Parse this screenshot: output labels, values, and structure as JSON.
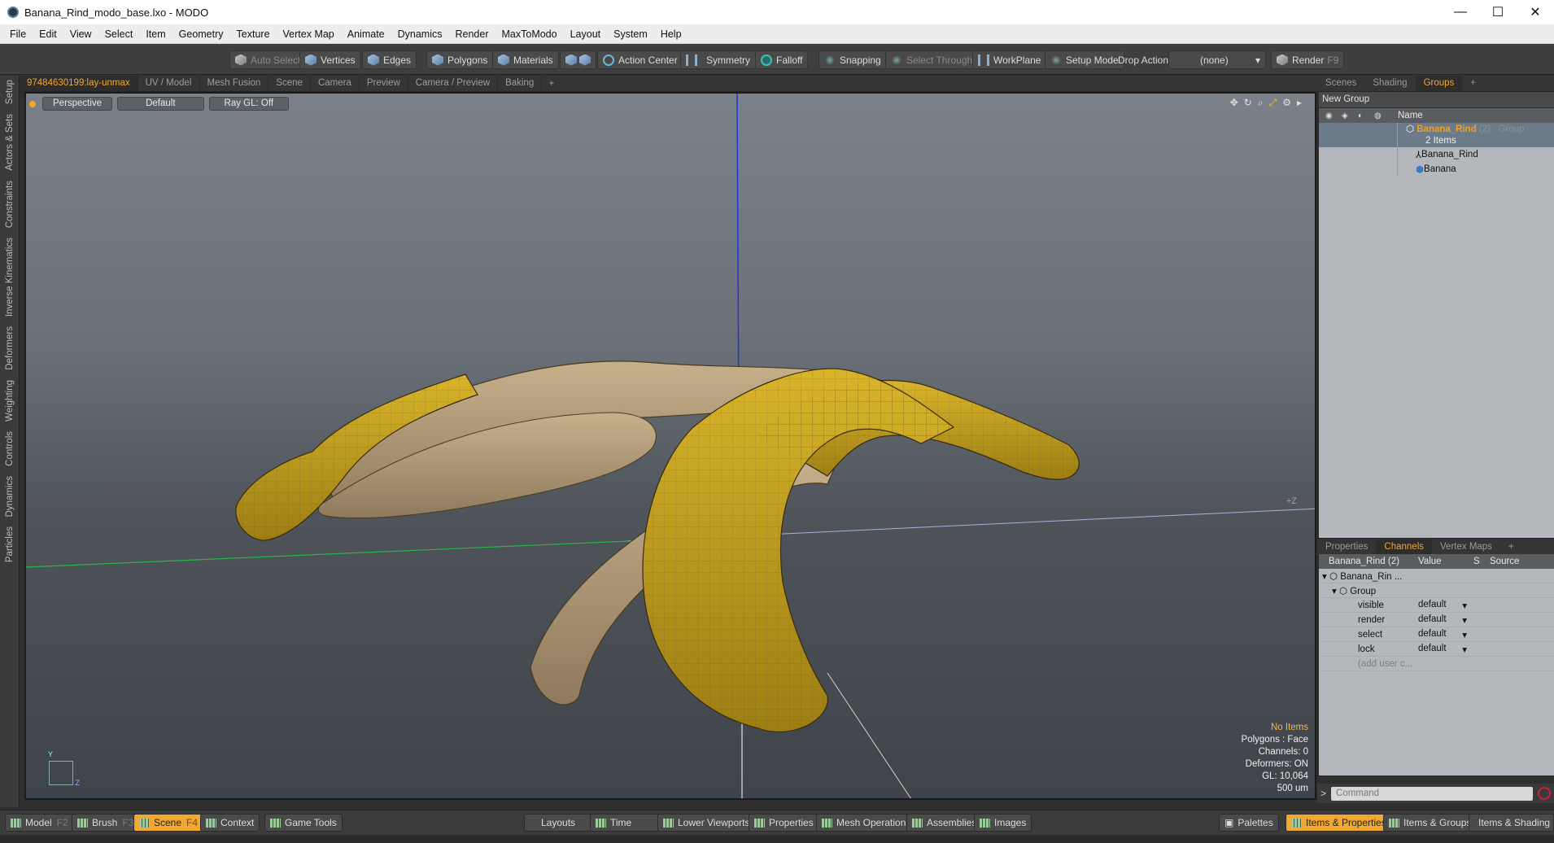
{
  "window": {
    "title": "Banana_Rind_modo_base.lxo - MODO",
    "min": "—",
    "max": "☐",
    "close": "✕"
  },
  "menu": [
    "File",
    "Edit",
    "View",
    "Select",
    "Item",
    "Geometry",
    "Texture",
    "Vertex Map",
    "Animate",
    "Dynamics",
    "Render",
    "MaxToModo",
    "Layout",
    "System",
    "Help"
  ],
  "toolbar": {
    "auto_select": "Auto Select",
    "vertices": "Vertices",
    "edges": "Edges",
    "polygons": "Polygons",
    "materials": "Materials",
    "action_center": "Action Center",
    "symmetry": "Symmetry",
    "falloff": "Falloff",
    "snapping": "Snapping",
    "select_through": "Select Through",
    "workplane": "WorkPlane",
    "setup_mode": "Setup Mode",
    "drop_action": "Drop Action",
    "drop_value": "(none)",
    "render": "Render",
    "render_key": "F9"
  },
  "left_tabs": [
    "Setup",
    "Actors & Sets",
    "Constraints",
    "Inverse Kinematics",
    "Deformers",
    "Weighting",
    "Controls",
    "Dynamics",
    "Particles"
  ],
  "viewport_tabs": [
    "97484630199:lay-unmax",
    "UV / Model",
    "Mesh Fusion",
    "Scene",
    "Camera",
    "Preview",
    "Camera / Preview",
    "Baking",
    "+"
  ],
  "viewport": {
    "view": "Perspective",
    "shading": "Default",
    "raygl": "Ray GL: Off",
    "info": {
      "no_items": "No Items",
      "polygons": "Polygons : Face",
      "channels": "Channels: 0",
      "deformers": "Deformers: ON",
      "gl": "GL: 10,064",
      "unit": "500 um"
    },
    "z_label": "+Z",
    "axis_y": "Y",
    "axis_z": "Z"
  },
  "right_tabs": [
    "Scenes",
    "Shading",
    "Groups",
    "+"
  ],
  "groups": {
    "new_group": "New Group",
    "col_name": "Name",
    "group_name": "Banana_Rind",
    "group_suffix": " (2) : Group",
    "item_count": "2 Items",
    "items": [
      "Banana_Rind",
      "Banana"
    ]
  },
  "channel_tabs": [
    "Properties",
    "Channels",
    "Vertex Maps",
    "+"
  ],
  "channels": {
    "head_name": "Banana_Rind (2)",
    "head_value": "Value",
    "head_s": "S",
    "head_source": "Source",
    "root": "Banana_Rin ...",
    "group": "Group",
    "rows": [
      {
        "name": "visible",
        "value": "default"
      },
      {
        "name": "render",
        "value": "default"
      },
      {
        "name": "select",
        "value": "default"
      },
      {
        "name": "lock",
        "value": "default"
      }
    ],
    "add_user": "(add user c..."
  },
  "command": {
    "prompt": ">",
    "placeholder": "Command"
  },
  "bottombar": {
    "model": "Model",
    "model_key": "F2",
    "brush": "Brush",
    "brush_key": "F3",
    "scene": "Scene",
    "scene_key": "F4",
    "context": "Context",
    "game_tools": "Game Tools",
    "layouts": "Layouts",
    "time": "Time",
    "lower_viewports": "Lower Viewports",
    "properties": "Properties",
    "mesh_operations": "Mesh Operations",
    "assemblies": "Assemblies",
    "images": "Images",
    "palettes": "Palettes",
    "items_properties": "Items & Properties",
    "items_groups": "Items & Groups",
    "items_shading": "Items & Shading"
  },
  "colors": {
    "accent": "#f0a830",
    "banana": "#c8a520",
    "rind_inner": "#b59f7c"
  }
}
